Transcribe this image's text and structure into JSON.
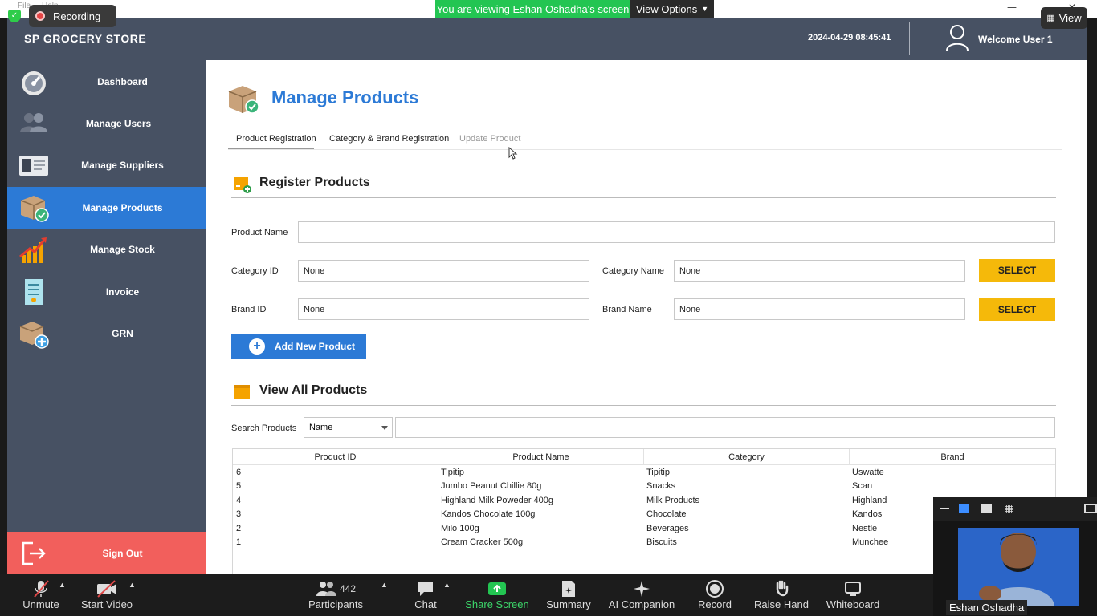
{
  "zoom": {
    "menu": [
      "File",
      "Help"
    ],
    "recording_label": "Recording",
    "viewing_banner": "You are viewing Eshan Oshadha's screen",
    "view_options_label": "View Options",
    "view_button_label": "View",
    "toolbar": [
      {
        "key": "unmute",
        "label": "Unmute",
        "icon": "mic-muted-icon"
      },
      {
        "key": "start_video",
        "label": "Start Video",
        "icon": "video-off-icon"
      },
      {
        "key": "participants",
        "label": "Participants",
        "count": "442",
        "icon": "participants-icon"
      },
      {
        "key": "chat",
        "label": "Chat",
        "icon": "chat-icon"
      },
      {
        "key": "share_screen",
        "label": "Share Screen",
        "icon": "share-screen-icon"
      },
      {
        "key": "summary",
        "label": "Summary",
        "icon": "summary-icon"
      },
      {
        "key": "ai_companion",
        "label": "AI Companion",
        "icon": "sparkle-icon"
      },
      {
        "key": "record",
        "label": "Record",
        "icon": "record-icon"
      },
      {
        "key": "raise_hand",
        "label": "Raise Hand",
        "icon": "hand-icon"
      },
      {
        "key": "whiteboard",
        "label": "Whiteboard",
        "icon": "whiteboard-icon"
      }
    ],
    "video_name": "Eshan Oshadha",
    "colors": {
      "banner_green": "#23c552",
      "share_green": "#23c552",
      "toolbar_bg": "#1c1c1c"
    }
  },
  "app": {
    "title": "SP GROCERY STORE",
    "datetime": "2024-04-29 08:45:41",
    "welcome": "Welcome User 1",
    "colors": {
      "header_bg": "#475163",
      "accent": "#2c7ad6",
      "select_btn": "#f5b90a",
      "signout": "#f25f5c"
    },
    "sidebar": {
      "items": [
        {
          "label": "Dashboard",
          "icon": "dashboard-gauge-icon"
        },
        {
          "label": "Manage Users",
          "icon": "users-icon"
        },
        {
          "label": "Manage Suppliers",
          "icon": "id-card-icon"
        },
        {
          "label": "Manage Products",
          "icon": "product-box-icon",
          "active": true
        },
        {
          "label": "Manage Stock",
          "icon": "growth-chart-icon"
        },
        {
          "label": "Invoice",
          "icon": "invoice-icon"
        },
        {
          "label": "GRN",
          "icon": "box-add-icon"
        }
      ],
      "signout": "Sign Out"
    },
    "page": {
      "title": "Manage Products",
      "tabs": [
        "Product Registration",
        "Category & Brand Registration",
        "Update Product"
      ],
      "register": {
        "heading": "Register Products",
        "product_name_label": "Product Name",
        "product_name_value": "",
        "category_id_label": "Category ID",
        "category_id_value": "None",
        "category_name_label": "Category Name",
        "category_name_value": "None",
        "brand_id_label": "Brand ID",
        "brand_id_value": "None",
        "brand_name_label": "Brand Name",
        "brand_name_value": "None",
        "select_label": "SELECT",
        "add_button": "Add New Product"
      },
      "view_all": {
        "heading": "View All Products",
        "search_label": "Search Products",
        "search_by": "Name",
        "search_value": "",
        "columns": [
          "Product ID",
          "Product Name",
          "Category",
          "Brand"
        ],
        "rows": [
          [
            "6",
            "Tipitip",
            "Tipitip",
            "Uswatte"
          ],
          [
            "5",
            "Jumbo Peanut Chillie 80g",
            "Snacks",
            "Scan"
          ],
          [
            "4",
            "Highland Milk Poweder 400g",
            "Milk Products",
            "Highland"
          ],
          [
            "3",
            "Kandos Chocolate 100g",
            "Chocolate",
            "Kandos"
          ],
          [
            "2",
            "Milo 100g",
            "Beverages",
            "Nestle"
          ],
          [
            "1",
            "Cream Cracker 500g",
            "Biscuits",
            "Munchee"
          ]
        ]
      }
    }
  }
}
